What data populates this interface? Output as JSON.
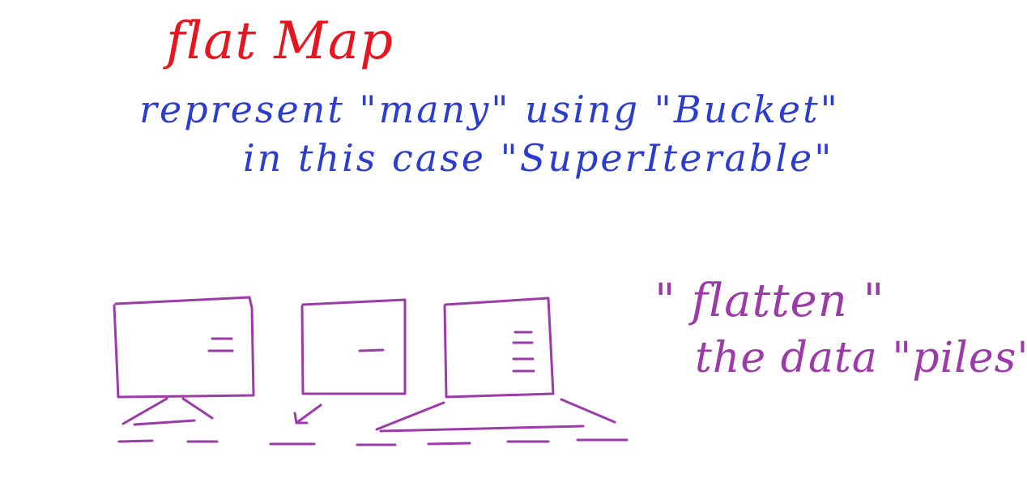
{
  "notes": {
    "title": "flat Map",
    "line1": "represent \"many\" using \"Bucket\"",
    "line2": "in this case \"SuperIterable\"",
    "flatten": "\" flatten \"",
    "piles": "the data \"piles\""
  },
  "colors": {
    "title": "#e8141e",
    "notes": "#2b3ccf",
    "drawing": "#9b3aa8"
  },
  "drawing": {
    "buckets": [
      {
        "marks": 2
      },
      {
        "marks": 1
      },
      {
        "marks": 4
      }
    ]
  }
}
